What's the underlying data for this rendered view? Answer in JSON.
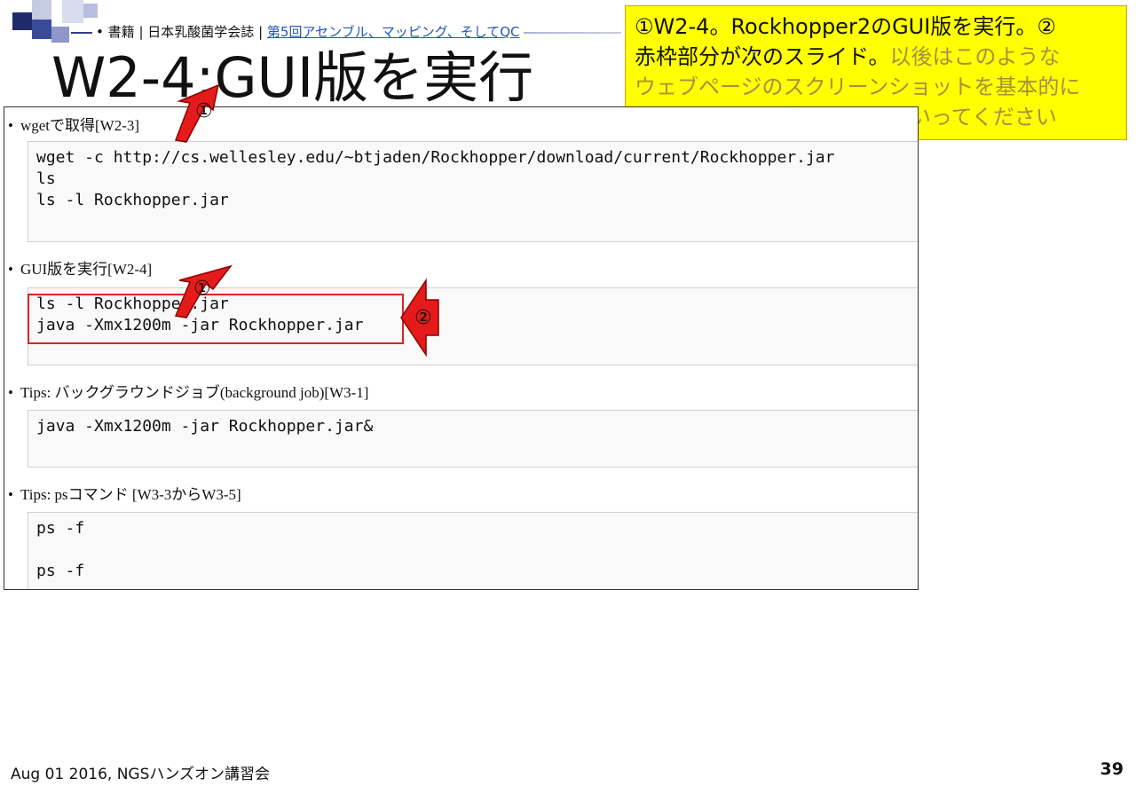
{
  "breadcrumb": {
    "bullet": "•",
    "part1": "書籍",
    "sep1": "|",
    "part2": "日本乳酸菌学会誌",
    "sep2": "|",
    "link": "第5回アセンブル、マッピング、そしてQC"
  },
  "slide_title": "W2-4:GUI版を実行",
  "note": {
    "line1": "①W2-4。Rockhopper2のGUI版を実行。②",
    "line2a": "赤枠部分が次のスライド。",
    "line2b": "以後はこのような",
    "line3": "ウェブページのスクリーンショットを基本的に",
    "line4": "示さないので、自分で辿っていってください",
    "colors": {
      "background": "#ffff00",
      "faint_text": "#a78f3f"
    }
  },
  "web": {
    "sections": [
      {
        "bullet": "wgetで取得[W2-3]",
        "code": [
          "wget -c http://cs.wellesley.edu/~btjaden/Rockhopper/download/current/Rockhopper.jar",
          "ls",
          "ls -l Rockhopper.jar"
        ]
      },
      {
        "bullet": "GUI版を実行[W2-4]",
        "code": [
          "ls -l Rockhopper.jar",
          "java -Xmx1200m -jar Rockhopper.jar"
        ]
      },
      {
        "bullet": "Tips: バックグラウンドジョブ(background job)[W3-1]",
        "code": [
          "java -Xmx1200m -jar Rockhopper.jar&"
        ]
      },
      {
        "bullet": "Tips: psコマンド [W3-3からW3-5]",
        "code": [
          "ps -f",
          "",
          "ps -f"
        ]
      }
    ]
  },
  "callouts": {
    "one": "①",
    "two": "②"
  },
  "footer": "Aug 01 2016, NGSハンズオン講習会",
  "page_number": "39",
  "colors": {
    "highlight_red": "#e02020",
    "arrow_fill": "#e51b1b"
  }
}
